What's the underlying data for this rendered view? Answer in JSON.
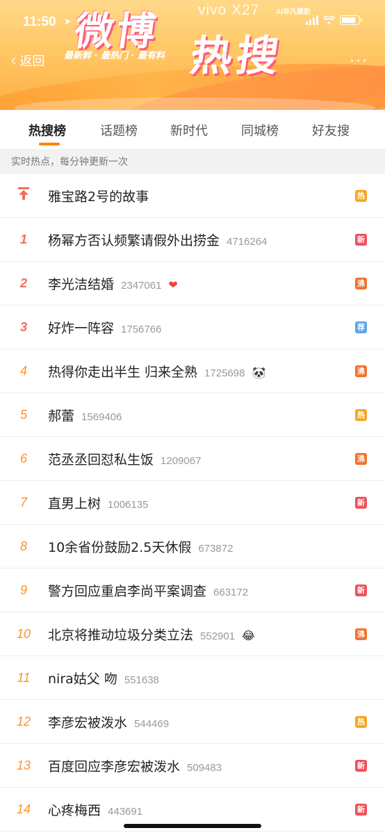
{
  "status_bar": {
    "time": "11:50",
    "brand": "vivo X27",
    "ai_label": "AI非凡摄影"
  },
  "banner": {
    "title_part1": "微博",
    "title_part2": "热搜",
    "slogan": "最新鲜 · 最热门 · 最有料"
  },
  "nav": {
    "back_label": "返回",
    "more_label": "···"
  },
  "tabs": [
    {
      "label": "热搜榜"
    },
    {
      "label": "话题榜"
    },
    {
      "label": "新时代"
    },
    {
      "label": "同城榜"
    },
    {
      "label": "好友搜"
    }
  ],
  "info_text": "实时热点，每分钟更新一次",
  "badge_colors": {
    "热": "#f5a623",
    "新": "#f0505a",
    "沸": "#f6702d",
    "荐": "#58a6ee"
  },
  "items": [
    {
      "rank": "",
      "title": "雅宝路2号的故事",
      "count": "",
      "emoji": "",
      "badge": "热"
    },
    {
      "rank": "1",
      "title": "杨幂方否认频繁请假外出捞金",
      "count": "4716264",
      "emoji": "",
      "badge": "新"
    },
    {
      "rank": "2",
      "title": "李光洁结婚",
      "count": "2347061",
      "emoji": "❤",
      "badge": "沸"
    },
    {
      "rank": "3",
      "title": "好炸一阵容",
      "count": "1756766",
      "emoji": "",
      "badge": "荐"
    },
    {
      "rank": "4",
      "title": "热得你走出半生 归来全熟",
      "count": "1725698",
      "emoji": "🐼",
      "badge": "沸"
    },
    {
      "rank": "5",
      "title": "郝蕾",
      "count": "1569406",
      "emoji": "",
      "badge": "热"
    },
    {
      "rank": "6",
      "title": "范丞丞回怼私生饭",
      "count": "1209067",
      "emoji": "",
      "badge": "沸"
    },
    {
      "rank": "7",
      "title": "直男上树",
      "count": "1006135",
      "emoji": "",
      "badge": "新"
    },
    {
      "rank": "8",
      "title": "10余省份鼓励2.5天休假",
      "count": "673872",
      "emoji": "",
      "badge": ""
    },
    {
      "rank": "9",
      "title": "警方回应重启李尚平案调查",
      "count": "663172",
      "emoji": "",
      "badge": "新"
    },
    {
      "rank": "10",
      "title": "北京将推动垃圾分类立法",
      "count": "552901",
      "emoji": "😂",
      "badge": "沸"
    },
    {
      "rank": "11",
      "title": "nira姑父 吻",
      "count": "551638",
      "emoji": "",
      "badge": ""
    },
    {
      "rank": "12",
      "title": "李彦宏被泼水",
      "count": "544469",
      "emoji": "",
      "badge": "热"
    },
    {
      "rank": "13",
      "title": "百度回应李彦宏被泼水",
      "count": "509483",
      "emoji": "",
      "badge": "新"
    },
    {
      "rank": "14",
      "title": "心疼梅西",
      "count": "443691",
      "emoji": "",
      "badge": "新"
    }
  ]
}
